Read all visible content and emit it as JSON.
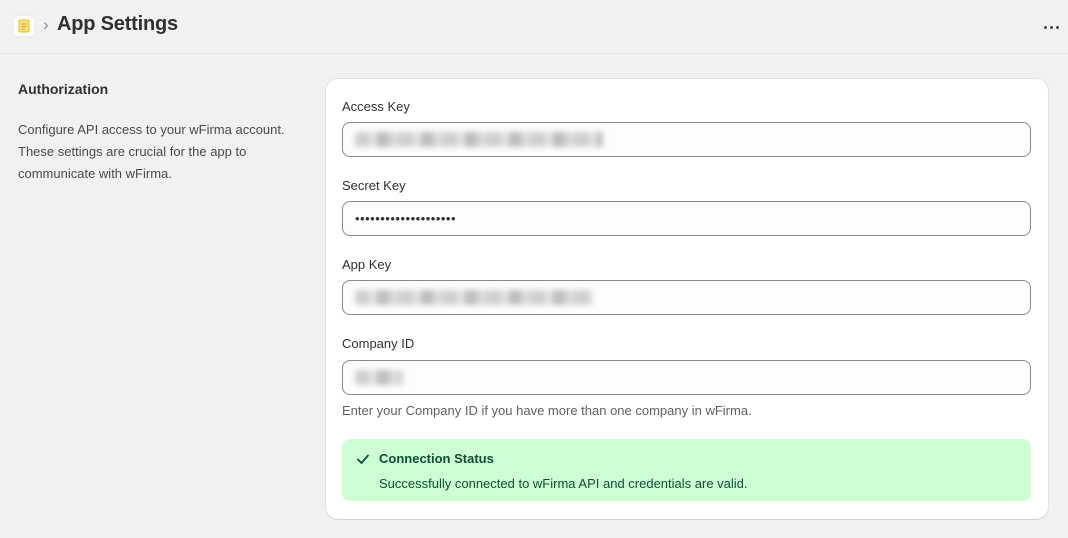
{
  "header": {
    "breadcrumb_separator": "›",
    "title": "App Settings",
    "app_icon": "document-icon",
    "more_icon": "more-horizontal-icon"
  },
  "section": {
    "title": "Authorization",
    "description": "Configure API access to your wFirma account. These settings are crucial for the app to communicate with wFirma."
  },
  "form": {
    "access_key": {
      "label": "Access Key",
      "value_hidden": true
    },
    "secret_key": {
      "label": "Secret Key",
      "value": "••••••••••••••••••••"
    },
    "app_key": {
      "label": "App Key",
      "value_hidden": true
    },
    "company_id": {
      "label": "Company ID",
      "value_hidden": true,
      "help": "Enter your Company ID if you have more than one company in wFirma."
    }
  },
  "status_banner": {
    "title": "Connection Status",
    "message": "Successfully connected to wFirma API and credentials are valid.",
    "icon": "checkmark-icon",
    "background": "#cdfed4",
    "text_color": "#0c5132"
  }
}
